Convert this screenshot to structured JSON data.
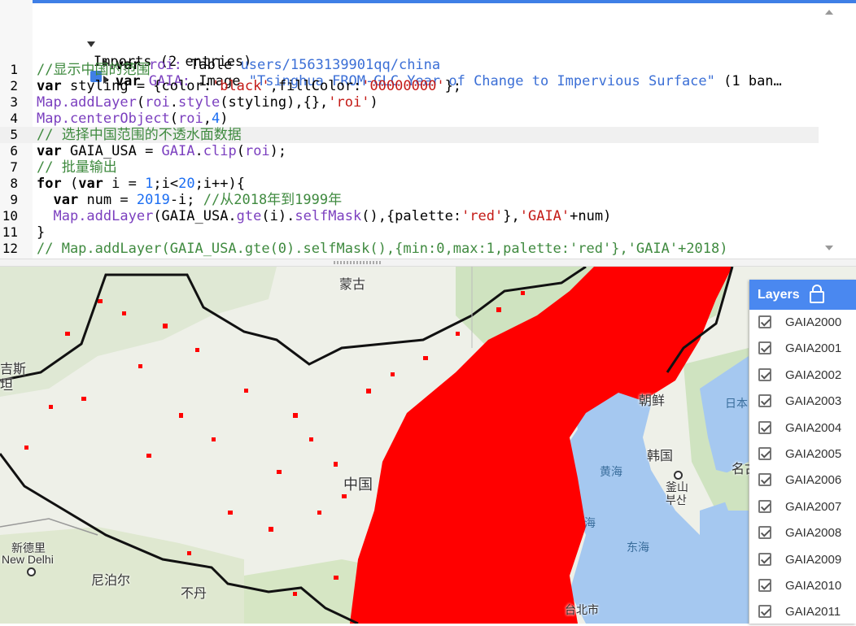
{
  "editor": {
    "imports_header": "Imports (2 entries)",
    "imports": [
      {
        "keyword": "var",
        "name": "roi:",
        "type": "Table",
        "value": "users/1563139901qq/china",
        "rest": ""
      },
      {
        "keyword": "var",
        "name": "GAIA:",
        "type": "Image",
        "value": "\"Tsinghua FROM-GLC Year of Change to Impervious Surface\"",
        "rest": " (1 ban…"
      }
    ],
    "lines": [
      {
        "n": "1",
        "parts": [
          {
            "c": "cmt",
            "t": "//显示中国的范围"
          }
        ]
      },
      {
        "n": "2",
        "parts": [
          {
            "c": "kw",
            "t": "var"
          },
          {
            "c": "",
            "t": " styling = {color:"
          },
          {
            "c": "str",
            "t": "'black'"
          },
          {
            "c": "",
            "t": ",fillColor:"
          },
          {
            "c": "str",
            "t": "'00000000'"
          },
          {
            "c": "",
            "t": "};"
          }
        ]
      },
      {
        "n": "3",
        "parts": [
          {
            "c": "fn",
            "t": "Map.addLayer"
          },
          {
            "c": "",
            "t": "("
          },
          {
            "c": "var",
            "t": "roi"
          },
          {
            "c": "",
            "t": "."
          },
          {
            "c": "fn",
            "t": "style"
          },
          {
            "c": "",
            "t": "(styling),{},"
          },
          {
            "c": "str",
            "t": "'roi'"
          },
          {
            "c": "",
            "t": ")"
          }
        ]
      },
      {
        "n": "4",
        "parts": [
          {
            "c": "fn",
            "t": "Map.centerObject"
          },
          {
            "c": "",
            "t": "("
          },
          {
            "c": "var",
            "t": "roi"
          },
          {
            "c": "",
            "t": ","
          },
          {
            "c": "num",
            "t": "4"
          },
          {
            "c": "",
            "t": ")"
          }
        ]
      },
      {
        "n": "5",
        "parts": [
          {
            "c": "cmt",
            "t": "// 选择中国范围的不透水面数据"
          }
        ]
      },
      {
        "n": "6",
        "parts": [
          {
            "c": "kw",
            "t": "var"
          },
          {
            "c": "",
            "t": " GAIA_USA = "
          },
          {
            "c": "var",
            "t": "GAIA"
          },
          {
            "c": "",
            "t": "."
          },
          {
            "c": "fn",
            "t": "clip"
          },
          {
            "c": "",
            "t": "("
          },
          {
            "c": "var",
            "t": "roi"
          },
          {
            "c": "",
            "t": ");"
          }
        ]
      },
      {
        "n": "7",
        "parts": [
          {
            "c": "cmt",
            "t": "// 批量输出"
          }
        ]
      },
      {
        "n": "8",
        "parts": [
          {
            "c": "kw",
            "t": "for"
          },
          {
            "c": "",
            "t": " ("
          },
          {
            "c": "kw",
            "t": "var"
          },
          {
            "c": "",
            "t": " i = "
          },
          {
            "c": "num",
            "t": "1"
          },
          {
            "c": "",
            "t": ";i<"
          },
          {
            "c": "num",
            "t": "20"
          },
          {
            "c": "",
            "t": ";i++){"
          }
        ]
      },
      {
        "n": "9",
        "parts": [
          {
            "c": "",
            "t": "  "
          },
          {
            "c": "kw",
            "t": "var"
          },
          {
            "c": "",
            "t": " num = "
          },
          {
            "c": "num",
            "t": "2019"
          },
          {
            "c": "",
            "t": "-i; "
          },
          {
            "c": "cmt",
            "t": "//从2018年到1999年"
          }
        ]
      },
      {
        "n": "10",
        "parts": [
          {
            "c": "",
            "t": "  "
          },
          {
            "c": "fn",
            "t": "Map.addLayer"
          },
          {
            "c": "",
            "t": "(GAIA_USA."
          },
          {
            "c": "fn",
            "t": "gte"
          },
          {
            "c": "",
            "t": "(i)."
          },
          {
            "c": "fn",
            "t": "selfMask"
          },
          {
            "c": "",
            "t": "(),{palette:"
          },
          {
            "c": "str",
            "t": "'red'"
          },
          {
            "c": "",
            "t": "},"
          },
          {
            "c": "str",
            "t": "'GAIA'"
          },
          {
            "c": "",
            "t": "+num)"
          }
        ]
      },
      {
        "n": "11",
        "parts": [
          {
            "c": "",
            "t": "}"
          }
        ]
      },
      {
        "n": "12",
        "parts": [
          {
            "c": "cmt",
            "t": "// Map.addLayer(GAIA_USA.gte(0).selfMask(),{min:0,max:1,palette:'red'},'GAIA'+2018)"
          }
        ]
      }
    ]
  },
  "map": {
    "labels": [
      {
        "text": "蒙古",
        "kind": "land"
      },
      {
        "text": "吉斯",
        "kind": "land"
      },
      {
        "text": "坦",
        "kind": "land"
      },
      {
        "text": "中国",
        "kind": "land"
      },
      {
        "text": "新德里",
        "kind": "land"
      },
      {
        "text": "New Delhi",
        "kind": "land"
      },
      {
        "text": "尼泊尔",
        "kind": "land"
      },
      {
        "text": "不丹",
        "kind": "land"
      },
      {
        "text": "朝鲜",
        "kind": "land"
      },
      {
        "text": "韩国",
        "kind": "land"
      },
      {
        "text": "釜山",
        "kind": "land"
      },
      {
        "text": "부산",
        "kind": "land"
      },
      {
        "text": "台北市",
        "kind": "land"
      },
      {
        "text": "名古",
        "kind": "land"
      },
      {
        "text": "日本",
        "kind": "sea"
      },
      {
        "text": "黄海",
        "kind": "sea"
      },
      {
        "text": "东海",
        "kind": "sea"
      },
      {
        "text": "海",
        "kind": "sea"
      }
    ]
  },
  "layers": {
    "title": "Layers",
    "items": [
      "GAIA2000",
      "GAIA2001",
      "GAIA2002",
      "GAIA2003",
      "GAIA2004",
      "GAIA2005",
      "GAIA2006",
      "GAIA2007",
      "GAIA2008",
      "GAIA2009",
      "GAIA2010",
      "GAIA2011"
    ]
  },
  "colors": {
    "accent": "#4a88f0",
    "impervious": "#ff0000",
    "water": "#a5c8f0"
  }
}
